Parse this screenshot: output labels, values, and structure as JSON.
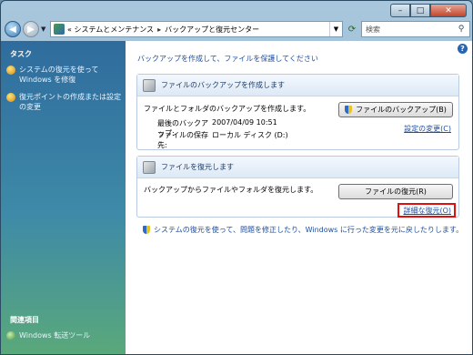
{
  "window": {
    "minimize": "–",
    "maximize": "□",
    "close": "✕"
  },
  "nav": {
    "breadcrumb_prefix": "«",
    "breadcrumb": [
      "システムとメンテナンス",
      "バックアップと復元センター"
    ],
    "breadcrumb_sep": "▸",
    "search_placeholder": "検索"
  },
  "sidebar": {
    "title": "タスク",
    "items": [
      "システムの復元を使って Windows を修復",
      "復元ポイントの作成または設定の変更"
    ],
    "related_title": "関連項目",
    "related_items": [
      "Windows 転送ツール"
    ]
  },
  "main": {
    "intro": "バックアップを作成して、ファイルを保護してください",
    "backup_panel": {
      "title": "ファイルのバックアップを作成します",
      "description": "ファイルとフォルダのバックアップを作成します。",
      "last_backup_label": "最後のバックアップ:",
      "last_backup_value": "2007/04/09 10:51",
      "location_label": "ファイルの保存先:",
      "location_value": "ローカル ディスク (D:)",
      "button": "ファイルのバックアップ(B)",
      "link": "設定の変更(C)"
    },
    "restore_panel": {
      "title": "ファイルを復元します",
      "description": "バックアップからファイルやフォルダを復元します。",
      "button": "ファイルの復元(R)",
      "link": "詳細な復元(O)"
    },
    "bottom_link": "システムの復元を使って、問題を修正したり、Windows に行った変更を元に戻したりします。"
  }
}
